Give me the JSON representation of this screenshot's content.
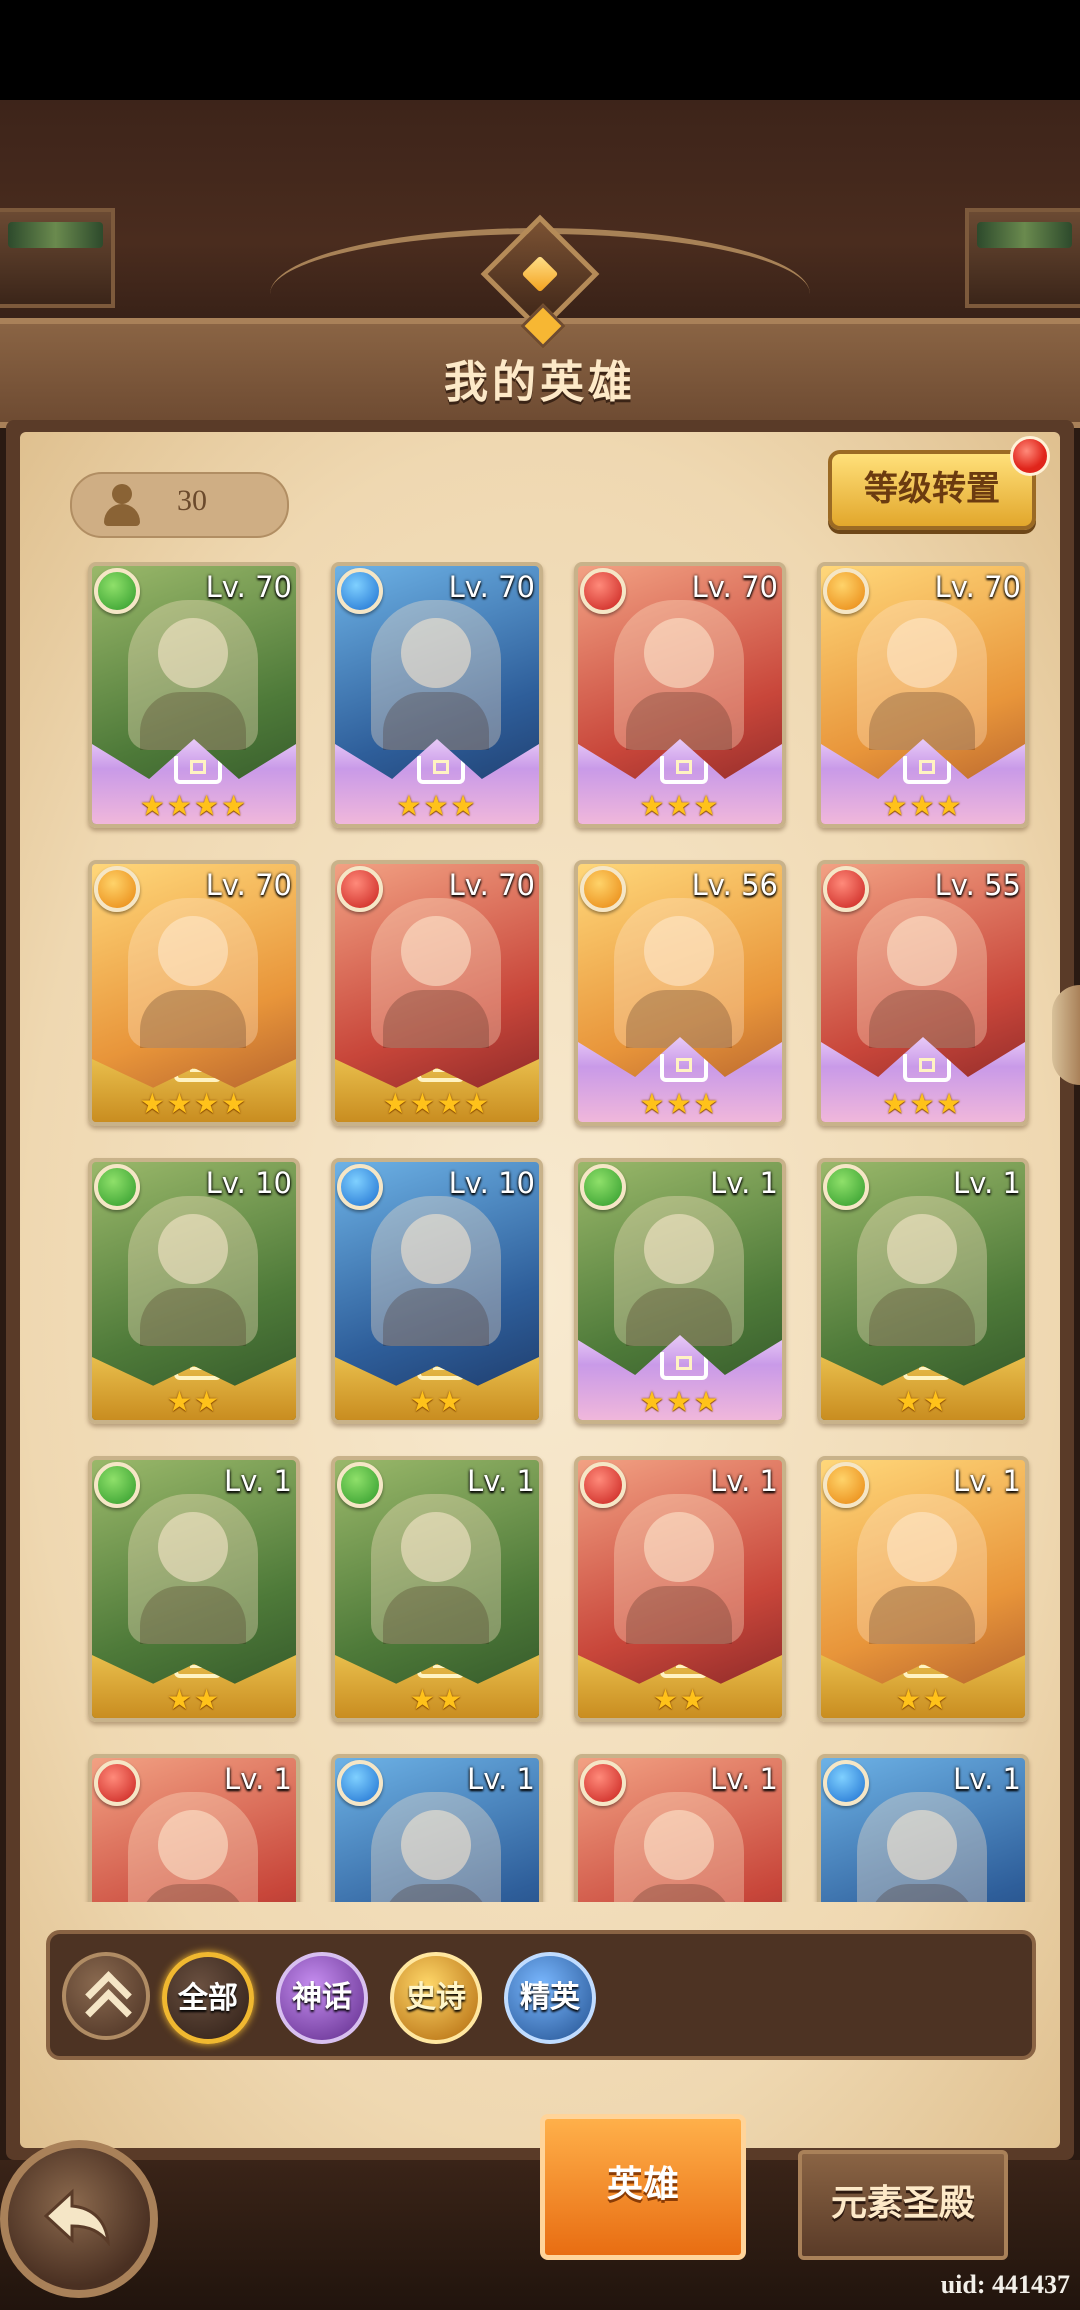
{
  "header": {
    "title": "我的英雄"
  },
  "toolbar": {
    "hero_count": "30",
    "transfer_label": "等级转置"
  },
  "heroes": [
    {
      "element": "green",
      "level": "Lv. 70",
      "stars": "★★★★",
      "frame": "purple"
    },
    {
      "element": "blue",
      "level": "Lv. 70",
      "stars": "★★★",
      "frame": "purple"
    },
    {
      "element": "red",
      "level": "Lv. 70",
      "stars": "★★★",
      "frame": "purple"
    },
    {
      "element": "orange",
      "level": "Lv. 70",
      "stars": "★★★",
      "frame": "purple"
    },
    {
      "element": "orange",
      "level": "Lv. 70",
      "stars": "★★★★",
      "frame": "gold"
    },
    {
      "element": "red",
      "level": "Lv. 70",
      "stars": "★★★★",
      "frame": "gold"
    },
    {
      "element": "orange",
      "level": "Lv. 56",
      "stars": "★★★",
      "frame": "purple"
    },
    {
      "element": "red",
      "level": "Lv. 55",
      "stars": "★★★",
      "frame": "purple"
    },
    {
      "element": "green",
      "level": "Lv. 10",
      "stars": "★★",
      "frame": "gold"
    },
    {
      "element": "blue",
      "level": "Lv. 10",
      "stars": "★★",
      "frame": "gold"
    },
    {
      "element": "green",
      "level": "Lv. 1",
      "stars": "★★★",
      "frame": "purple"
    },
    {
      "element": "green",
      "level": "Lv. 1",
      "stars": "★★",
      "frame": "gold"
    },
    {
      "element": "green",
      "level": "Lv. 1",
      "stars": "★★",
      "frame": "gold"
    },
    {
      "element": "green",
      "level": "Lv. 1",
      "stars": "★★",
      "frame": "gold"
    },
    {
      "element": "red",
      "level": "Lv. 1",
      "stars": "★★",
      "frame": "gold"
    },
    {
      "element": "orange",
      "level": "Lv. 1",
      "stars": "★★",
      "frame": "gold"
    },
    {
      "element": "red",
      "level": "Lv. 1",
      "stars": "",
      "frame": "gold"
    },
    {
      "element": "blue",
      "level": "Lv. 1",
      "stars": "",
      "frame": "gold"
    },
    {
      "element": "red",
      "level": "Lv. 1",
      "stars": "",
      "frame": "gold"
    },
    {
      "element": "blue",
      "level": "Lv. 1",
      "stars": "",
      "frame": "gold"
    }
  ],
  "filters": {
    "all": "全部",
    "mythic": "神话",
    "epic": "史诗",
    "elite": "精英"
  },
  "tabs": {
    "hero": "英雄",
    "element_temple": "元素圣殿"
  },
  "footer": {
    "uid": "uid: 441437"
  },
  "colors": {
    "green": "#2f9a2b",
    "blue": "#1d6fd0",
    "red": "#c8201c",
    "orange": "#e8850f",
    "accent_gold": "#f0b830"
  },
  "icons": {
    "element_green": "🜃",
    "element_blue": "💧",
    "element_red": "🔥",
    "element_orange": "◆"
  }
}
